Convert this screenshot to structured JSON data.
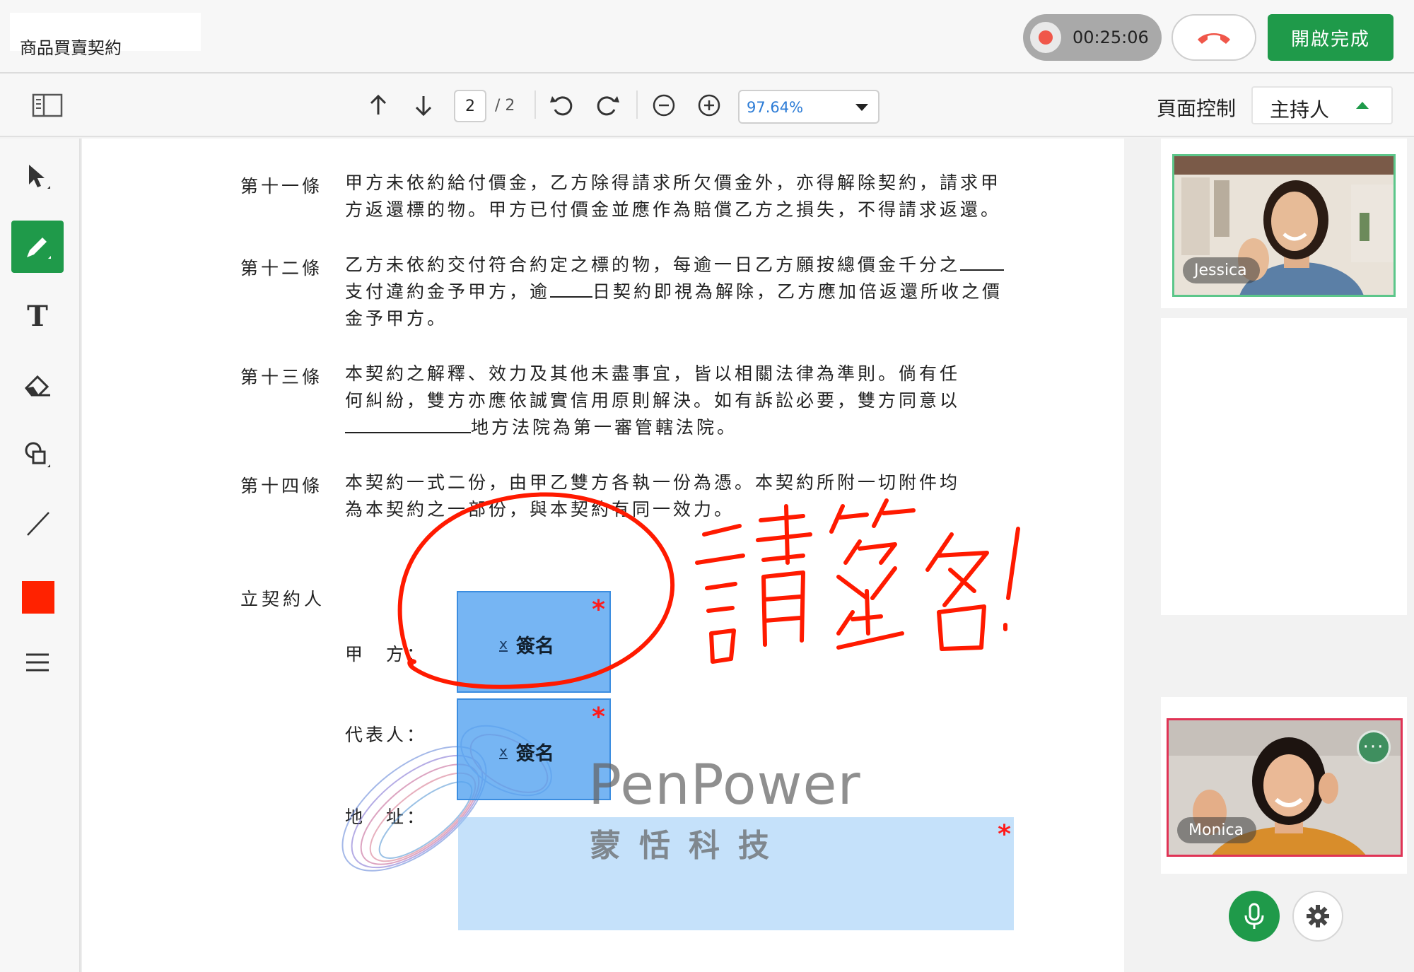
{
  "header": {
    "title": "商品買賣契約",
    "timer": "00:25:06",
    "finish_label": "開啟完成"
  },
  "toolbar": {
    "current_page": "2",
    "total_pages": "/ 2",
    "zoom": "97.64%",
    "page_control_label": "頁面控制",
    "role_selected": "主持人"
  },
  "document": {
    "articles": [
      {
        "label": "第十一條",
        "lines": [
          "甲方未依約給付價金，乙方除得請求所欠價金外，亦得解除契約，請求甲",
          "方返還標的物。甲方已付價金並應作為賠償乙方之損失，不得請求返還。"
        ]
      },
      {
        "label": "第十二條",
        "lines": [
          "乙方未依約交付符合約定之標的物，每逾一日乙方願按總價金千分之",
          "支付違約金予甲方，逾",
          "日契約即視為解除，乙方應加倍返還所收之價",
          "金予甲方。"
        ]
      },
      {
        "label": "第十三條",
        "lines": [
          "本契約之解釋、效力及其他未盡事宜，皆以相關法律為準則。倘有任",
          "何糾紛，雙方亦應依誠實信用原則解決。如有訴訟必要，雙方同意以",
          "地方法院為第一審管轄法院。"
        ]
      },
      {
        "label": "第十四條",
        "lines": [
          "本契約一式二份，由甲乙雙方各執一份為憑。本契約所附一切附件均",
          "為本契約之一部份，與本契約有同一效力。"
        ]
      }
    ],
    "parties_title": "立契約人",
    "party_a_label": "甲　方：",
    "representative_label": "代表人：",
    "address_label": "地　址：",
    "signature_field_label": "簽名",
    "signature_x_mark": "x",
    "required_mark": "*"
  },
  "watermark": {
    "brand": "PenPower",
    "chinese": "蒙恬科技"
  },
  "participants": [
    {
      "name": "Jessica"
    },
    {
      "name": "Monica",
      "more_glyph": "···"
    }
  ],
  "colors": {
    "accent_green": "#1f9a4a",
    "record_red": "#f0574a",
    "pen_color": "#ff2200",
    "signature_blue": "#54a3f0",
    "speaker_border": "#e03355"
  },
  "icons": {
    "sidebar_toggle": "sidebar-toggle-icon",
    "prev_page": "arrow-up-icon",
    "next_page": "arrow-down-icon",
    "rotate_left": "rotate-left-icon",
    "rotate_right": "rotate-right-icon",
    "zoom_out": "zoom-out-icon",
    "zoom_in": "zoom-in-icon",
    "tools": [
      "pointer-icon",
      "pen-icon",
      "text-icon",
      "eraser-icon",
      "shapes-icon",
      "line-icon",
      "color-swatch",
      "menu-icon"
    ],
    "mic": "microphone-icon",
    "settings": "gear-icon",
    "hangup": "hangup-icon"
  }
}
